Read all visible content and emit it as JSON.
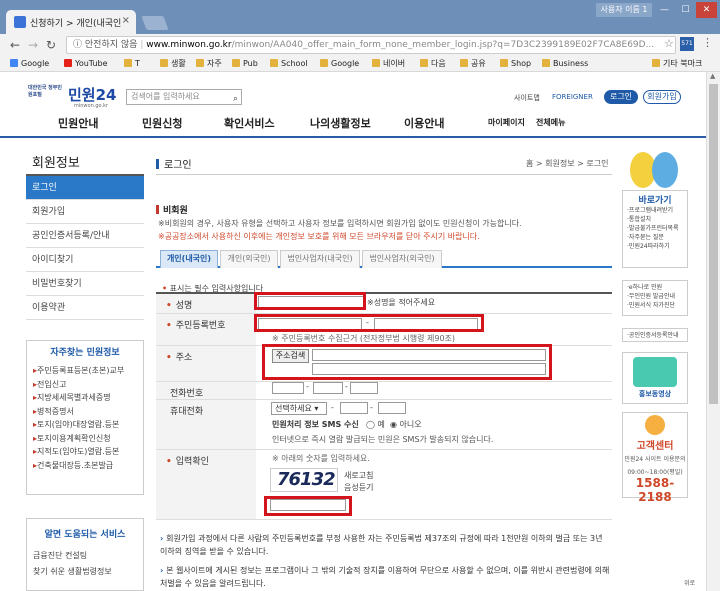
{
  "browser": {
    "tab_title": "신청하기 > 개인(내국인",
    "user_label": "사용자 이름 1",
    "security_label": "안전하지 않음",
    "url_domain": "www.minwon.go.kr",
    "url_path": "/minwon/AA040_offer_main_form_none_member_login.jsp?q=7D3C2399189E02F7CA8E69D...",
    "bookmarks": [
      "Google",
      "YouTube",
      "T",
      "생활",
      "자주",
      "Pub",
      "School",
      "Google",
      "네이버",
      "다음",
      "공유",
      "Shop",
      "Business",
      "기타 북마크"
    ]
  },
  "header": {
    "logo_small": "대한민국 정부민원포털",
    "logo_big": "민원24",
    "logo_url": "minwon.go.kr",
    "search_placeholder": "검색어를 입력하세요",
    "sitemap": "사이트맵",
    "foreigner": "FOREIGNER",
    "login": "로그인",
    "join": "회원가입",
    "menus": [
      "민원안내",
      "민원신청",
      "확인서비스",
      "나의생활정보",
      "이용안내"
    ],
    "mypage": "마이페이지",
    "allmenu": "전체메뉴"
  },
  "sidebar": {
    "title": "회원정보",
    "items": [
      "로그인",
      "회원가입",
      "공인인증서등록/안내",
      "아이디찾기",
      "비밀번호찾기",
      "이용약관"
    ],
    "fav_title": "자주찾는 민원정보",
    "fav_items": [
      "주민등록표등본(초본)교부",
      "전입신고",
      "지방세세목별과세증명",
      "병적증명서",
      "토지(임야)대장열람.등본",
      "토지이용계획확인신청",
      "지적도(임야도)열람.등본",
      "건축물대장등.초본발급"
    ],
    "help_title": "알면 도움되는 서비스",
    "help_items": [
      "금융진단 컨설팅",
      "찾기 쉬운 생활법령정보"
    ]
  },
  "main": {
    "page_title": "로그인",
    "breadcrumb": "홈 > 회원정보 > 로그인",
    "section_title": "비회원",
    "note1": "※비회원의 경우, 사용자 유형을 선택하고 사용자 정보를 입력하시면 회원가입 없이도 민원신청이 가능합니다.",
    "note2": "※공공장소에서 사용하신 이후에는 개인정보 보호를 위해 모든 브라우저를 닫아 주시기 바랍니다.",
    "tabs": [
      "개인(내국인)",
      "개인(외국인)",
      "법인사업자(내국인)",
      "법인사업자(외국인)"
    ],
    "required_note": "표시는 필수 입력사항입니다",
    "form": {
      "name_label": "성명",
      "name_hint": "※성명을 적어주세요",
      "rrn_label": "주민등록번호",
      "rrn_hint": "※ 주민등록번호 수집근거 (전자정부법 시행령 제90조)",
      "addr_label": "주소",
      "addr_button": "주소검색",
      "phone_label": "전화번호",
      "mobile_label": "휴대전화",
      "mobile_select": "선택하세요",
      "sms_label": "민원처리 정보 SMS 수신",
      "sms_yes": "예",
      "sms_no": "아니오",
      "sms_note": "인터넷으로 즉시 열람 발급되는 민원은 SMS가 발송되지 않습니다.",
      "captcha_label": "입력확인",
      "captcha_hint": "※ 아래의 숫자를 입력하세요.",
      "captcha_text": "76132",
      "refresh": "새로고침",
      "audio": "음성듣기"
    },
    "bullet1": "회원가입 과정에서 다른 사람의 주민등록번호를 부정 사용한 자는 주민등록법 제37조의 규정에 따라 1천만원 이하의 벌금 또는 3년 이하의 징역을 받을 수 있습니다.",
    "bullet2": "본 웹사이트에 게시된 정보는 프로그램이나 그 밖의 기술적 장치를 이용하여 무단으로 사용할 수 없으며, 이를 위반시 관련법령에 의해 처벌을 수 있음을 알려드립니다."
  },
  "right": {
    "box1_title": "바로가기",
    "box1_items": [
      "프로그램내려받기",
      "통합설치",
      "발급불가프린터목록",
      "자주묻는 질문",
      "민원24따라하기"
    ],
    "box2_items": [
      "e하나로 민원",
      "무인민원 발급안내",
      "민원서식 자가진단"
    ],
    "box3_item": "공인인증서등록안내",
    "promo": "홍보동영상",
    "center_title": "고객센터",
    "center_sub": "민원24 사이트 이용문의",
    "center_hours": "09:00~18:00(평일)",
    "phone": "1588-2188"
  },
  "scroll_label": "위로"
}
